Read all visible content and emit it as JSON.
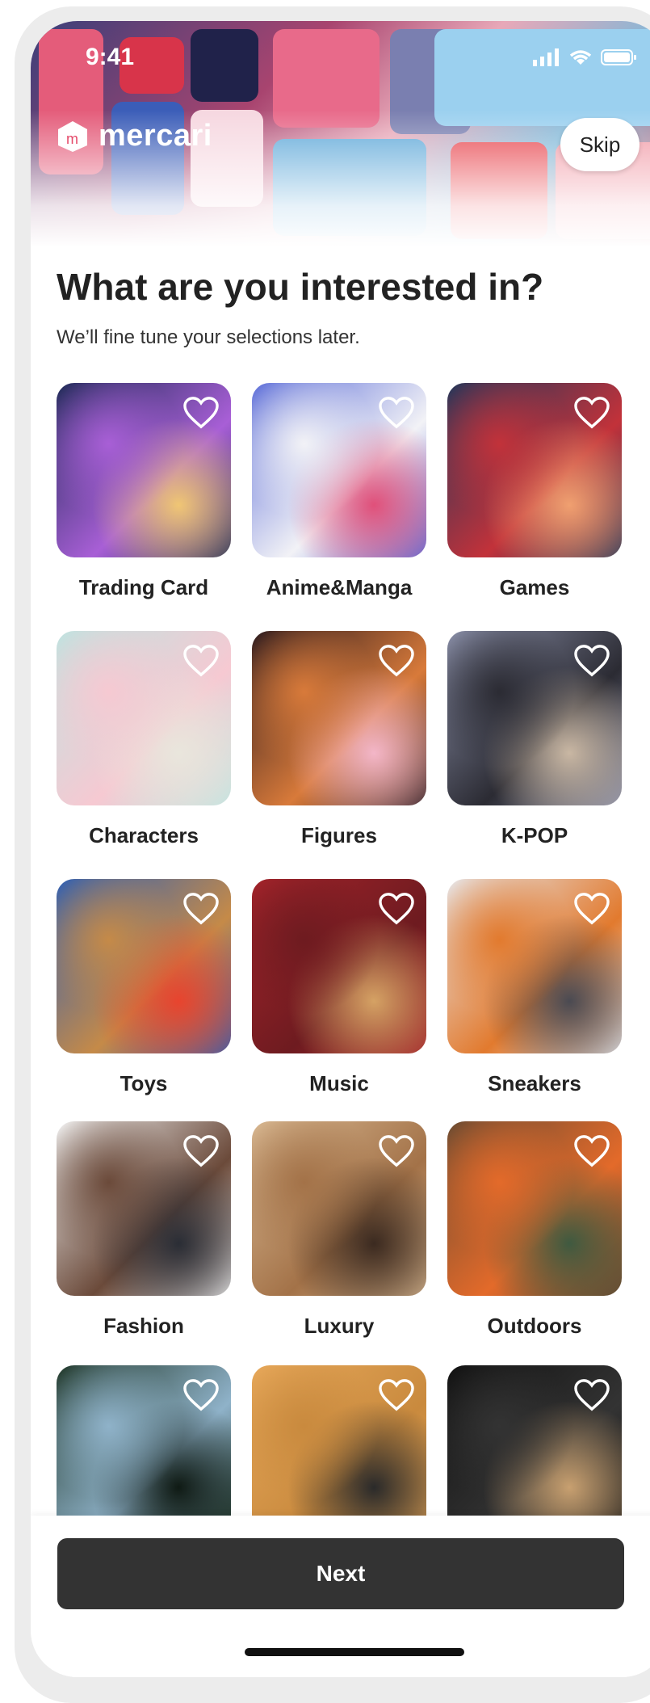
{
  "status_bar": {
    "time": "9:41"
  },
  "header": {
    "logo_text": "mercari",
    "skip_label": "Skip"
  },
  "main": {
    "title": "What are you interested in?",
    "subtitle": "We’ll fine tune your selections later."
  },
  "categories": [
    {
      "label": "Trading Card",
      "colors": [
        "#1d2a55",
        "#a85fd6",
        "#f0c674"
      ]
    },
    {
      "label": "Anime&Manga",
      "colors": [
        "#5b6cd8",
        "#f2f2f6",
        "#e0507a"
      ]
    },
    {
      "label": "Games",
      "colors": [
        "#22365a",
        "#c2323a",
        "#f0a070"
      ]
    },
    {
      "label": "Characters",
      "colors": [
        "#bfe3e0",
        "#f6c9d2",
        "#e9e6dc"
      ]
    },
    {
      "label": "Figures",
      "colors": [
        "#2b1a1e",
        "#d87a3a",
        "#f3b6c8"
      ]
    },
    {
      "label": "K-POP",
      "colors": [
        "#8a8fa8",
        "#2b2b33",
        "#c9b7a3"
      ]
    },
    {
      "label": "Toys",
      "colors": [
        "#2e5fb4",
        "#c58a48",
        "#e8442e"
      ]
    },
    {
      "label": "Music",
      "colors": [
        "#a3232a",
        "#6e1b20",
        "#d5a264"
      ]
    },
    {
      "label": "Sneakers",
      "colors": [
        "#e7e7ea",
        "#e27a2e",
        "#4a4a52"
      ]
    },
    {
      "label": "Fashion",
      "colors": [
        "#f2f2f2",
        "#6b4a3a",
        "#2a2d35"
      ]
    },
    {
      "label": "Luxury",
      "colors": [
        "#d8b892",
        "#a37248",
        "#3b2a20"
      ]
    },
    {
      "label": "Outdoors",
      "colors": [
        "#6a4b32",
        "#e36a2a",
        "#3f5a40"
      ]
    },
    {
      "label": "",
      "colors": [
        "#1e3526",
        "#8fb2c9",
        "#0f1a14"
      ]
    },
    {
      "label": "",
      "colors": [
        "#e7a85a",
        "#c98a3e",
        "#2a2a2a"
      ]
    },
    {
      "label": "",
      "colors": [
        "#111111",
        "#333333",
        "#c8a070"
      ]
    }
  ],
  "footer": {
    "next_label": "Next"
  },
  "colors": {
    "primary_button": "#333333",
    "text": "#222222"
  }
}
